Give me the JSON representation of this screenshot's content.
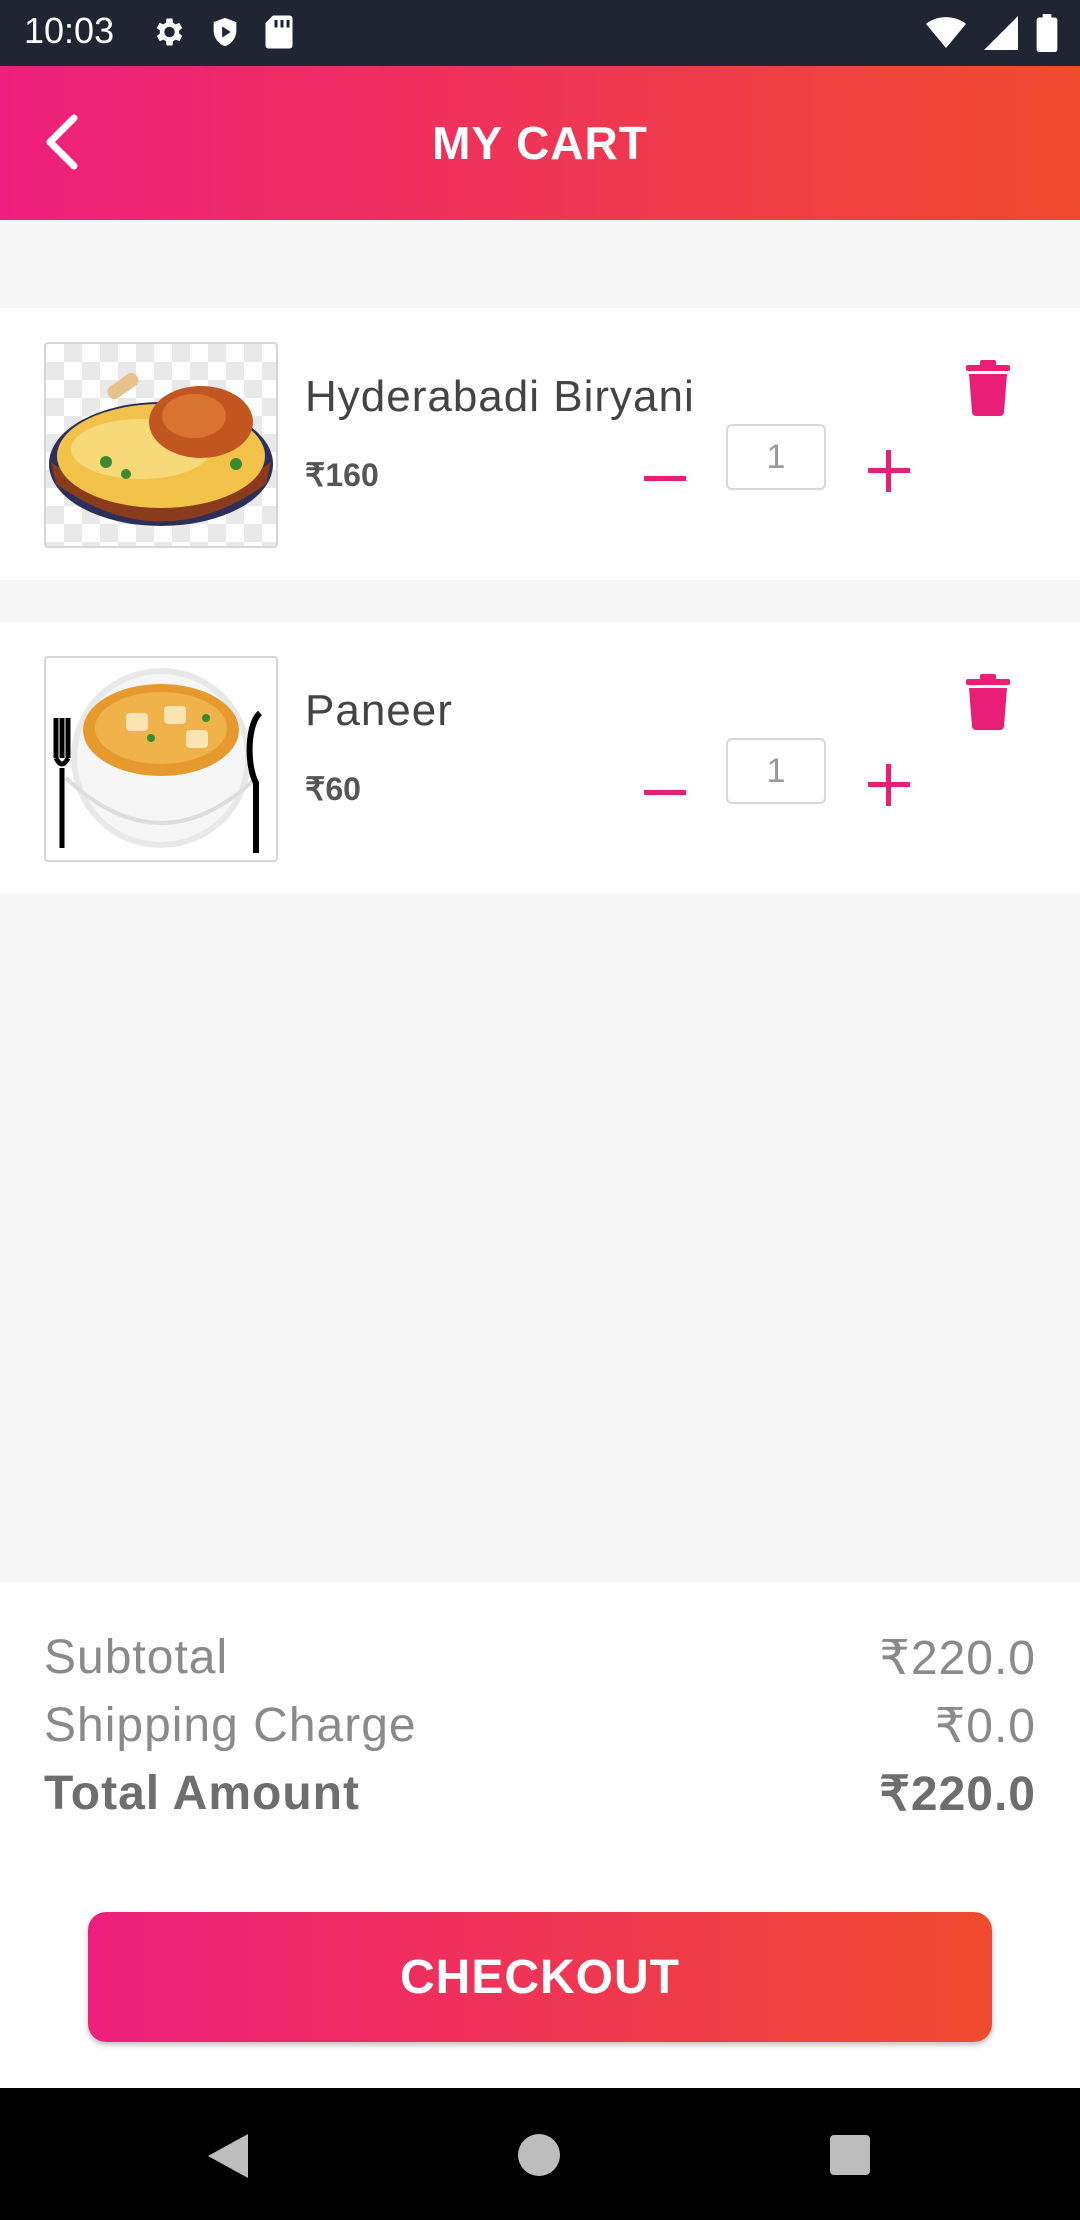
{
  "status_bar": {
    "time": "10:03",
    "left_icons": [
      "gear-icon",
      "shield-icon",
      "sd-card-icon"
    ],
    "right_icons": [
      "wifi-icon",
      "signal-icon",
      "battery-icon"
    ]
  },
  "header": {
    "title": "MY CART",
    "back_icon": "chevron-left-icon"
  },
  "cart": {
    "items": [
      {
        "name": "Hyderabadi Biryani",
        "price": "₹160",
        "quantity": "1"
      },
      {
        "name": "Paneer",
        "price": "₹60",
        "quantity": "1"
      }
    ]
  },
  "summary": {
    "subtotal_label": "Subtotal",
    "subtotal_value": "₹220.0",
    "shipping_label": "Shipping Charge",
    "shipping_value": "₹0.0",
    "total_label": "Total Amount",
    "total_value": "₹220.0"
  },
  "checkout": {
    "label": "CHECKOUT"
  },
  "colors": {
    "accent_start": "#ee1f7c",
    "accent_end": "#f04a2e",
    "accent_pink": "#e91e76"
  }
}
